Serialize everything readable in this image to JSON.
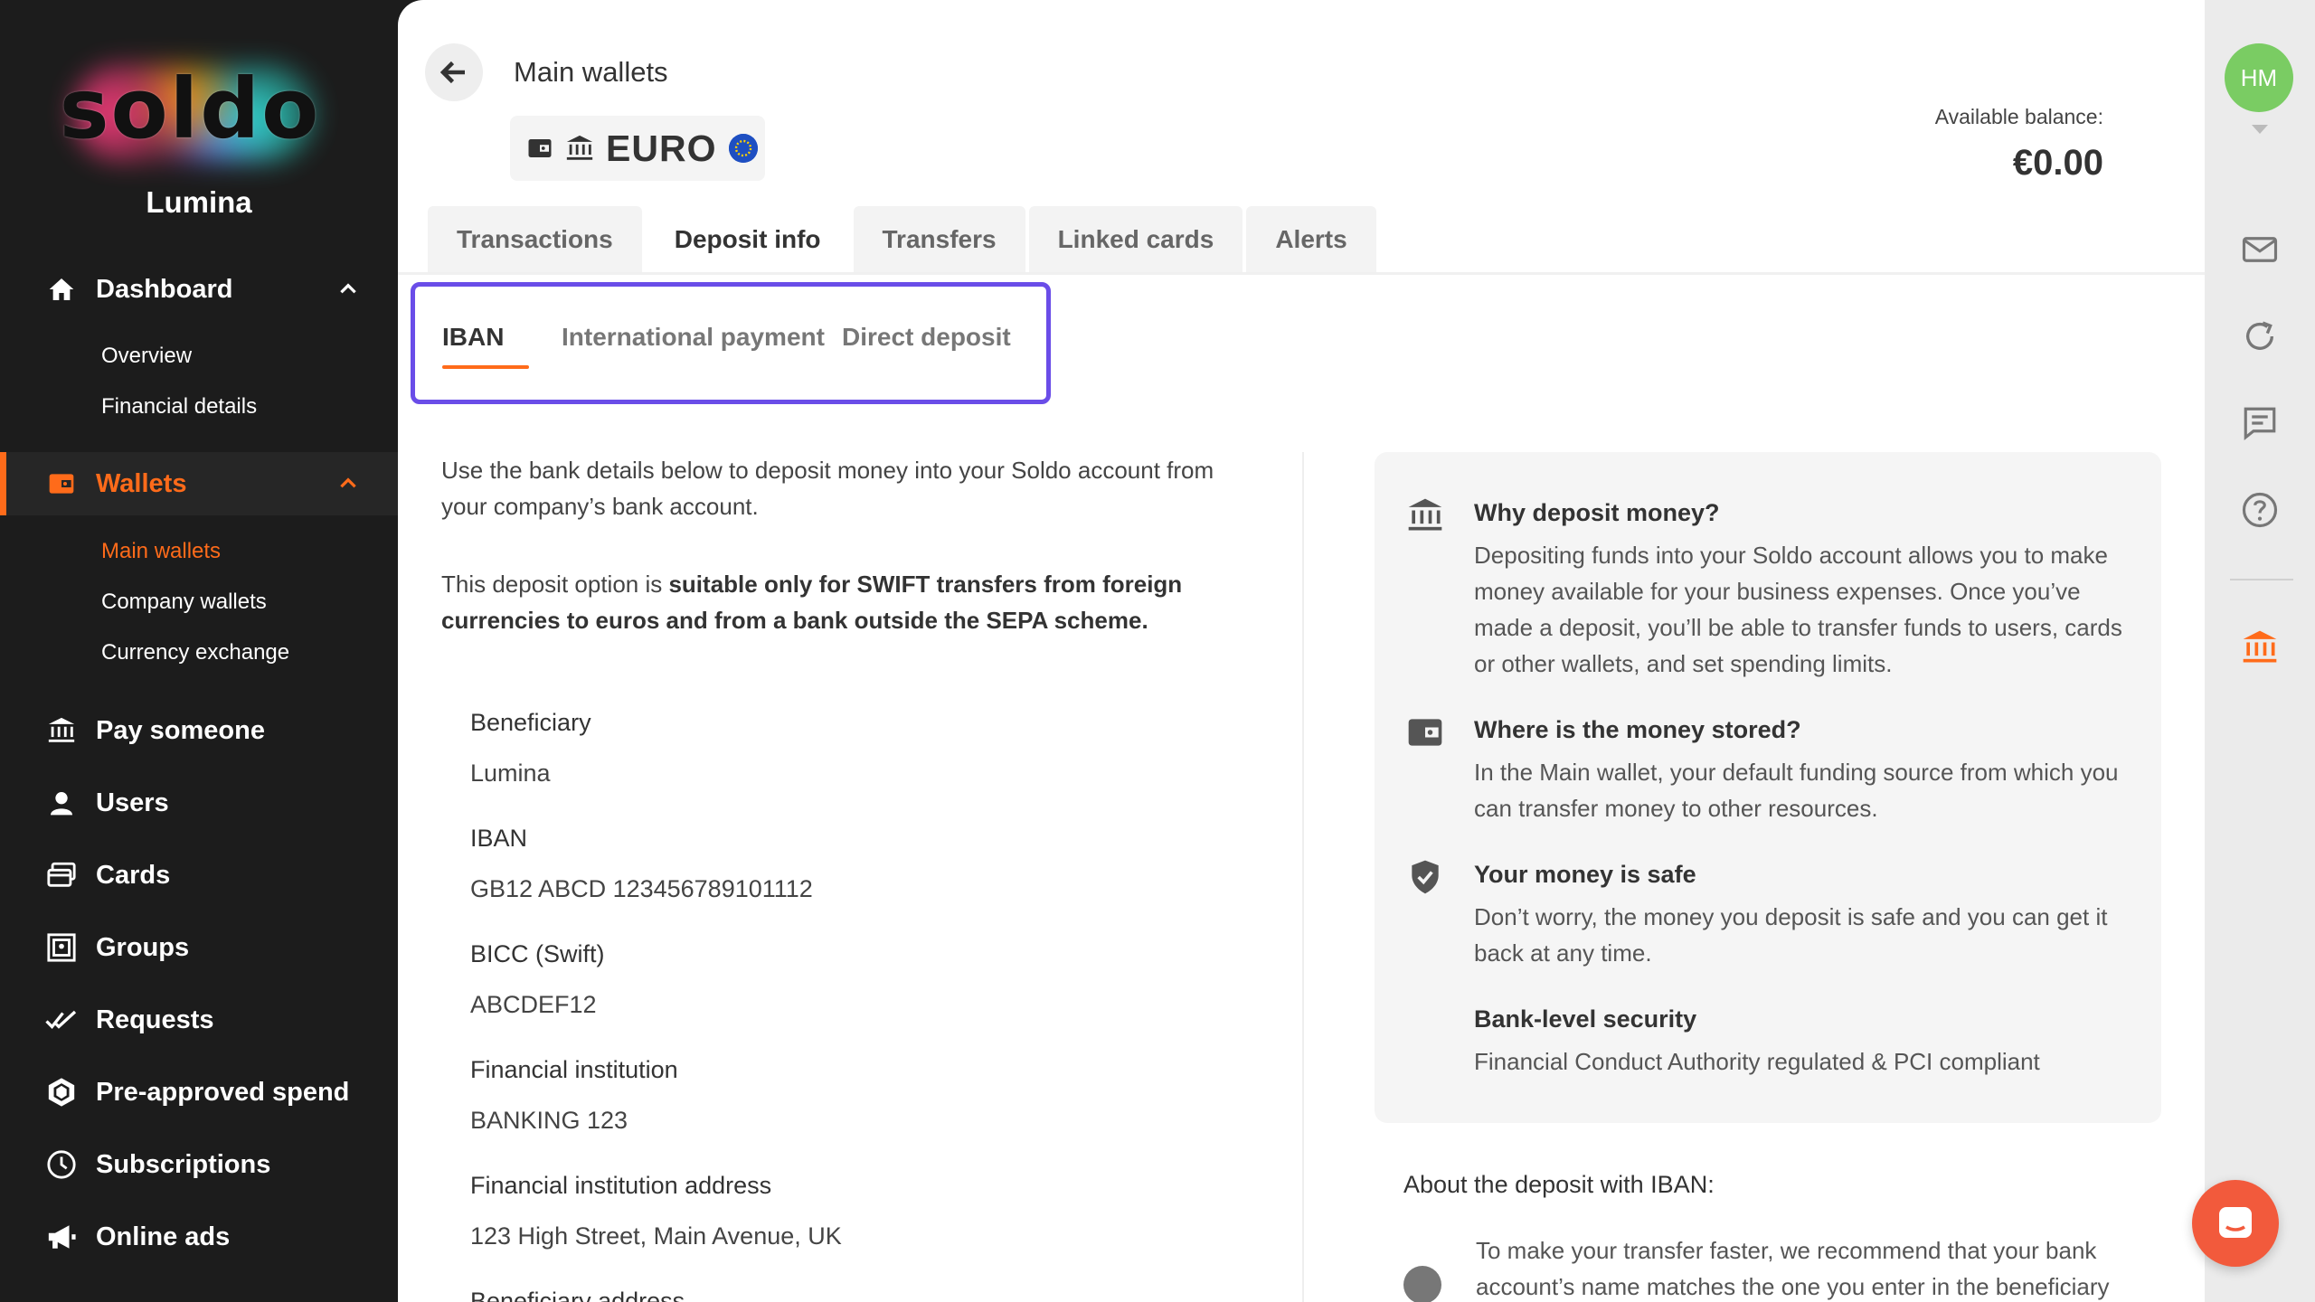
{
  "sidebar": {
    "logo": "soldo",
    "org_name": "Lumina",
    "nav": [
      {
        "label": "Dashboard"
      },
      {
        "label": "Wallets"
      },
      {
        "label": "Pay someone"
      },
      {
        "label": "Users"
      },
      {
        "label": "Cards"
      },
      {
        "label": "Groups"
      },
      {
        "label": "Requests"
      },
      {
        "label": "Pre-approved spend"
      },
      {
        "label": "Subscriptions"
      },
      {
        "label": "Online ads"
      }
    ],
    "dashboard_sub": [
      "Overview",
      "Financial details"
    ],
    "wallets_sub": [
      "Main wallets",
      "Company wallets",
      "Currency exchange"
    ],
    "accent_color": "#ff6b1a"
  },
  "header": {
    "title": "Main wallets",
    "wallet_name": "EURO",
    "balance_label": "Available balance:",
    "balance_value": "€0.00"
  },
  "tabs": [
    "Transactions",
    "Deposit info",
    "Transfers",
    "Linked cards",
    "Alerts"
  ],
  "subtabs": [
    "IBAN",
    "International payment",
    "Direct deposit"
  ],
  "deposit": {
    "intro": "Use the bank details below to deposit money into your Soldo account from your company’s bank account.",
    "note_prefix": "This deposit option is ",
    "note_bold": "suitable only for SWIFT transfers from foreign currencies to euros and from a bank outside the SEPA scheme.",
    "fields": [
      {
        "label": "Beneficiary",
        "value": "Lumina"
      },
      {
        "label": "IBAN",
        "value": "GB12 ABCD 123456789101112"
      },
      {
        "label": "BICC (Swift)",
        "value": "ABCDEF12"
      },
      {
        "label": "Financial institution",
        "value": "BANKING 123"
      },
      {
        "label": "Financial institution address",
        "value": "123 High Street, Main Avenue, UK"
      },
      {
        "label": "Beneficiary address"
      }
    ]
  },
  "info": {
    "items": [
      {
        "title": "Why deposit money?",
        "text": "Depositing funds into your Soldo account allows you to make money available for your business expenses. Once you’ve made a deposit, you’ll be able to transfer funds to users, cards or other wallets, and set spending limits."
      },
      {
        "title": "Where is the money stored?",
        "text": "In the Main wallet, your default funding source from which you can transfer money to other resources."
      },
      {
        "title": "Your money is safe",
        "text": "Don’t worry, the money you deposit is safe and you can get it back at any time."
      },
      {
        "title": "Bank-level security",
        "text": "Financial Conduct Authority regulated & PCI compliant"
      }
    ]
  },
  "about": {
    "title": "About the deposit with IBAN:",
    "text": "To make your transfer faster, we recommend that your bank account’s name matches the one you enter in the beneficiary"
  },
  "rail": {
    "avatar_initials": "HM",
    "avatar_color": "#7acc63"
  }
}
